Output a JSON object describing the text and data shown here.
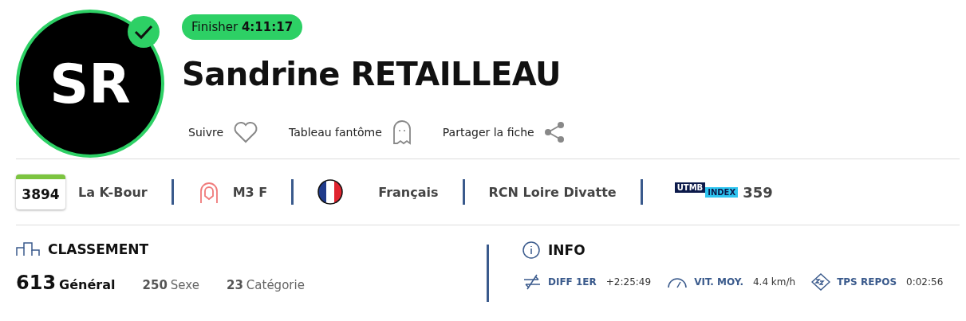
{
  "runner": {
    "initials": "SR",
    "finished": true,
    "status": "Finisher",
    "time": "4:11:17",
    "name": "Sandrine RETAILLEAU"
  },
  "actions": [
    {
      "kind": "follow",
      "label": "Suivre"
    },
    {
      "kind": "ghost",
      "label": "Tableau fantôme"
    },
    {
      "kind": "share",
      "label": "Partager la fiche"
    }
  ],
  "bib": {
    "number": "3894",
    "race": "La K-Bour"
  },
  "category": "M3 F",
  "nationality": "Français",
  "club": "RCN Loire Divatte",
  "index": {
    "brand": "UTMB",
    "label": "INDEX",
    "value": "359"
  },
  "ranking": {
    "title": "CLASSEMENT",
    "items": [
      {
        "kind": "main",
        "value": "613",
        "label": "Général"
      },
      {
        "kind": "minor",
        "value": "250",
        "label": "Sexe"
      },
      {
        "kind": "minor",
        "value": "23",
        "label": "Catégorie"
      }
    ]
  },
  "info": {
    "title": "INFO",
    "items": [
      {
        "kind": "diff",
        "label": "DIFF 1ER",
        "value": "+2:25:49"
      },
      {
        "kind": "speed",
        "label": "VIT. MOY.",
        "value": "4.4 km/h"
      },
      {
        "kind": "rest",
        "label": "TPS REPOS",
        "value": "0:02:56"
      }
    ]
  }
}
